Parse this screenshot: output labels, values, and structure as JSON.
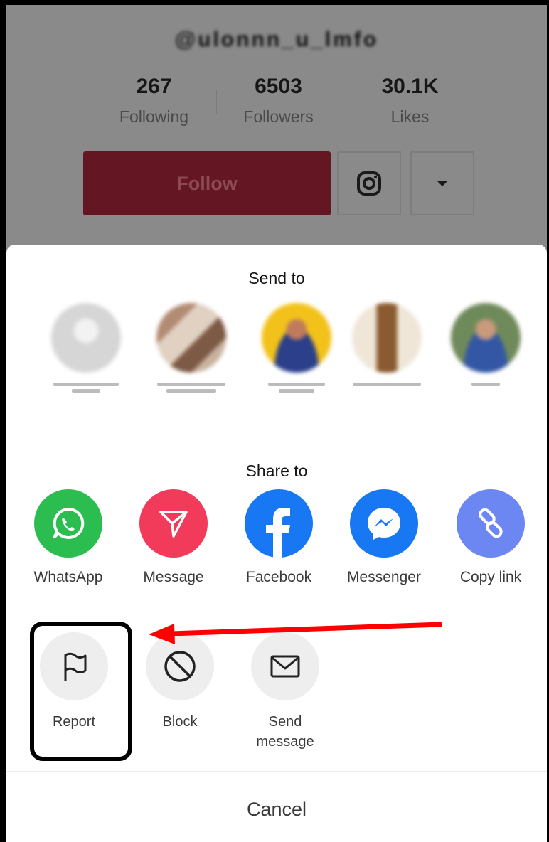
{
  "profile": {
    "username": "@ulonnn_u_lmfo",
    "stats": [
      {
        "value": "267",
        "label": "Following"
      },
      {
        "value": "6503",
        "label": "Followers"
      },
      {
        "value": "30.1K",
        "label": "Likes"
      }
    ],
    "follow_label": "Follow",
    "instagram_icon": "instagram-icon",
    "dropdown_icon": "caret-down-icon"
  },
  "sheet": {
    "send_to_title": "Send to",
    "contacts_colors": [
      "#d9d9d9",
      "#b99a86",
      "#f2c21a",
      "#d9c8b0",
      "#7d9468"
    ],
    "share_to_title": "Share to",
    "apps": [
      {
        "label": "WhatsApp",
        "color": "#2bbd4f",
        "icon": "whatsapp-icon"
      },
      {
        "label": "Message",
        "color": "#f23a5b",
        "icon": "paper-plane-icon"
      },
      {
        "label": "Facebook",
        "color": "#1877f2",
        "icon": "facebook-icon"
      },
      {
        "label": "Messenger",
        "color": "#1877f2",
        "icon": "messenger-icon"
      },
      {
        "label": "Copy link",
        "color": "#6c87f2",
        "icon": "link-icon"
      }
    ],
    "actions": [
      {
        "label": "Report",
        "icon": "flag-icon"
      },
      {
        "label": "Block",
        "icon": "block-icon"
      },
      {
        "label": "Send message",
        "icon": "envelope-icon"
      }
    ],
    "cancel_label": "Cancel"
  },
  "annotation": {
    "arrow_color": "#ff0000",
    "highlight_color": "#000000"
  }
}
